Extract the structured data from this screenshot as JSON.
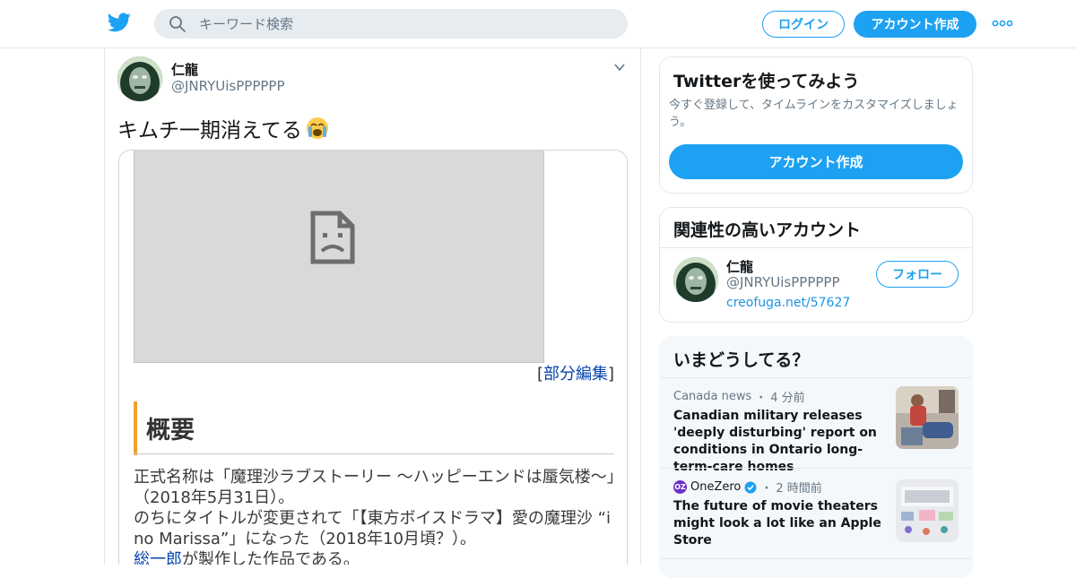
{
  "header": {
    "search_placeholder": "キーワード検索",
    "login_label": "ログイン",
    "signup_label": "アカウント作成",
    "brand_color": "#1da1f2"
  },
  "tweet": {
    "user_name": "仁龍",
    "user_handle": "@JNRYUisPPPPPP",
    "text": "キムチ一期消えてる",
    "emoji": "loudly-crying-face",
    "card": {
      "edit_open": "[",
      "edit_link": "部分編集",
      "edit_close": "]",
      "section_title": "概要",
      "para1": "正式名称は「魔理沙ラブストーリー 〜ハッピーエンドは蜃気楼〜」（2018年5月31日）。",
      "para2": "のちにタイトルが変更されて「【東方ボイスドラマ】愛の魔理沙 “i no Marissa”」になった（2018年10月頃？）。",
      "para3_link": "総一郎",
      "para3_rest": "が製作した作品である。"
    }
  },
  "sidebar": {
    "signup_panel": {
      "title": "Twitterを使ってみよう",
      "description": "今すぐ登録して、タイムラインをカスタマイズしましょう。",
      "button_label": "アカウント作成"
    },
    "related_panel": {
      "title": "関連性の高いアカウント",
      "account": {
        "name": "仁龍",
        "handle": "@JNRYUisPPPPPP",
        "link": "creofuga.net/57627",
        "follow_label": "フォロー"
      }
    },
    "trends_panel": {
      "title": "いまどうしてる？",
      "items": [
        {
          "source": "Canada news",
          "separator": "・",
          "time": "4 分前",
          "headline": "Canadian military releases 'deeply disturbing' report on conditions in Ontario long-term-care homes"
        },
        {
          "source_badge": "OZ",
          "source": "OneZero",
          "separator": "・",
          "time": "2 時間前",
          "headline": "The future of movie theaters might look a lot like an Apple Store"
        }
      ]
    }
  }
}
